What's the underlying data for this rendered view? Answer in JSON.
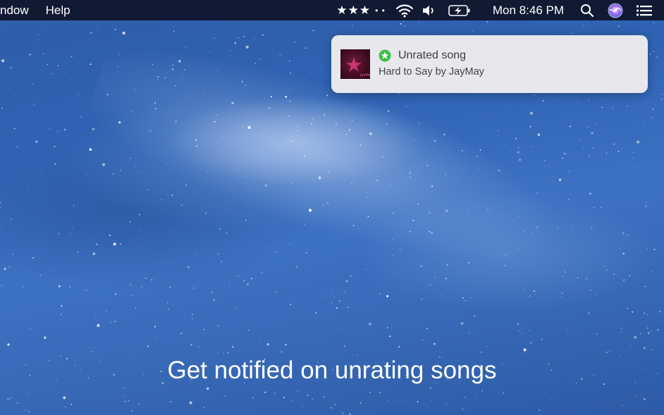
{
  "menubar": {
    "menus": [
      "ndow",
      "Help"
    ],
    "rating_stars": "★★★",
    "rating_dots": "• •",
    "clock": "Mon 8:46 PM",
    "icons": [
      "wifi-icon",
      "volume-icon",
      "battery-charging-icon",
      "search-icon",
      "siri-icon",
      "notification-center-icon"
    ]
  },
  "notification": {
    "title": "Unrated song",
    "subtitle": "Hard to Say by JayMay",
    "badge_color": "#3fbf4a"
  },
  "caption": "Get notified on unrating songs"
}
